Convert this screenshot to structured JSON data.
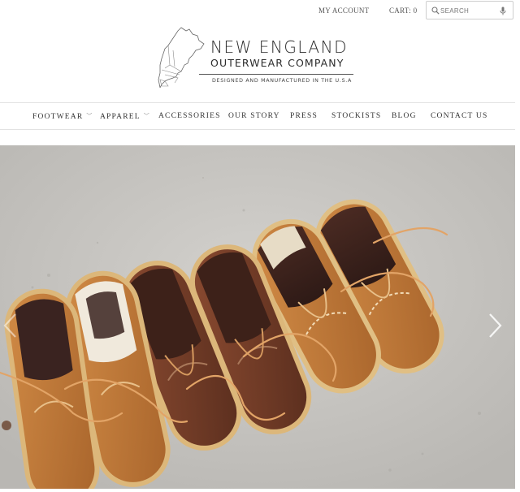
{
  "header": {
    "my_account": "MY ACCOUNT",
    "cart": "CART: 0",
    "search_placeholder": "SEARCH"
  },
  "brand": {
    "line1": "NEW ENGLAND",
    "line2": "OUTERWEAR COMPANY",
    "tagline": "DESIGNED AND MANUFACTURED IN THE U.S.A"
  },
  "nav": {
    "items": [
      {
        "label": "FOOTWEAR",
        "has_dropdown": true
      },
      {
        "label": "APPAREL",
        "has_dropdown": true
      },
      {
        "label": "ACCESSORIES",
        "has_dropdown": false
      },
      {
        "label": "OUR STORY",
        "has_dropdown": false
      },
      {
        "label": "PRESS",
        "has_dropdown": false
      },
      {
        "label": "STOCKISTS",
        "has_dropdown": false
      },
      {
        "label": "BLOG",
        "has_dropdown": false
      },
      {
        "label": "CONTACT US",
        "has_dropdown": false
      }
    ],
    "chevron": "﹀"
  },
  "hero": {
    "image": "three pairs of moccasin boat shoes on concrete",
    "icons": [
      "chevron-right-icon",
      "chevron-left-icon"
    ]
  },
  "colors": {
    "suede": "#c27a3a",
    "leather_brown": "#6b3a26",
    "concrete": "#c9c7c3",
    "crepe_sole": "#d9b67a",
    "text": "#333333"
  }
}
